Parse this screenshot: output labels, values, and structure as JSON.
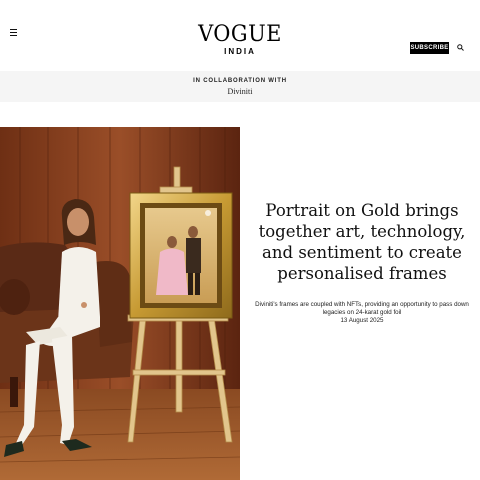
{
  "header": {
    "logo": "VOGUE",
    "logo_sub": "INDIA",
    "subscribe_label": "SUBSCRIBE",
    "menu_icon": "hamburger-menu-icon",
    "search_icon": "search-icon"
  },
  "collab": {
    "label": "IN COLLABORATION WITH",
    "partner": "Diviniti"
  },
  "article": {
    "headline": "Portrait on Gold brings together art, technology, and sentiment to create personalised frames",
    "dek": "Diviniti's frames are coupled with NFTs, providing an opportunity to pass down legacies on 24-karat gold foil",
    "date": "13 August 2025"
  },
  "colors": {
    "accent": "#000000",
    "band_bg": "#f5f5f5",
    "gold": "#c9a43c",
    "wood": "#7a3a1c"
  }
}
